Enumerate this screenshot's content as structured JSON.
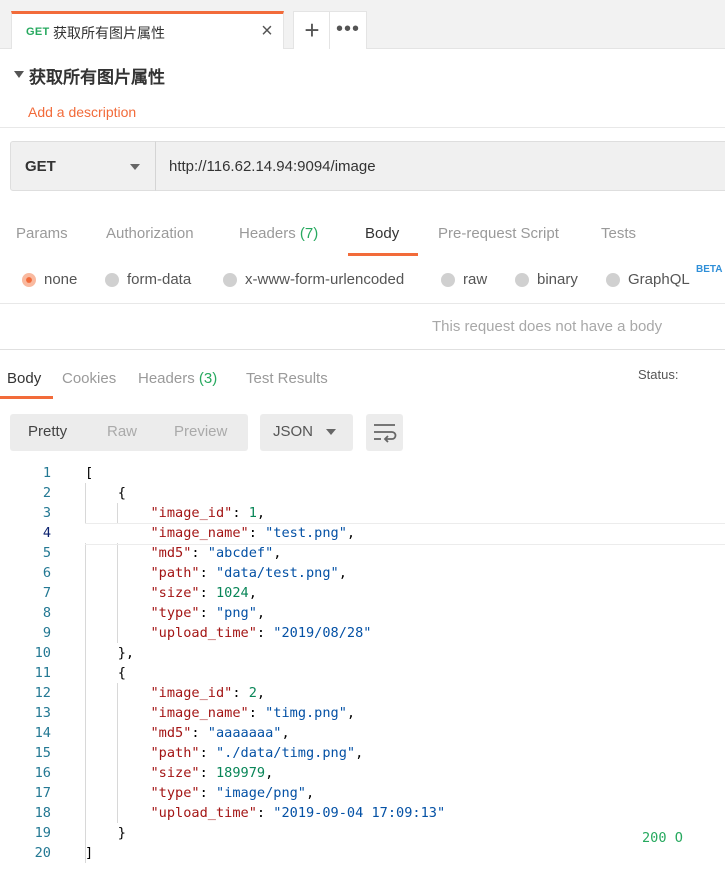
{
  "tab": {
    "method": "GET",
    "name": "获取所有图片属性",
    "close": "×",
    "add": "+",
    "more": "•••"
  },
  "request": {
    "title": "获取所有图片属性",
    "add_description": "Add a description",
    "method": "GET",
    "url": "http://116.62.14.94:9094/image"
  },
  "request_tabs": [
    {
      "label": "Params"
    },
    {
      "label": "Authorization"
    },
    {
      "label": "Headers",
      "count": "(7)"
    },
    {
      "label": "Body"
    },
    {
      "label": "Pre-request Script"
    },
    {
      "label": "Tests"
    }
  ],
  "body_types": [
    "none",
    "form-data",
    "x-www-form-urlencoded",
    "raw",
    "binary",
    "GraphQL"
  ],
  "body_types_selected": "none",
  "beta": "BETA",
  "no_body_text": "This request does not have a body",
  "response_tabs": [
    {
      "label": "Body"
    },
    {
      "label": "Cookies"
    },
    {
      "label": "Headers",
      "count": "(3)"
    },
    {
      "label": "Test Results"
    }
  ],
  "status": {
    "label": "Status:",
    "value": "200 O"
  },
  "view_modes": [
    "Pretty",
    "Raw",
    "Preview"
  ],
  "view_mode_selected": "Pretty",
  "format": "JSON",
  "highlighted_line": 4,
  "code_lines": [
    [
      [
        "p",
        "["
      ]
    ],
    [
      [
        "p",
        "    {"
      ]
    ],
    [
      [
        "p",
        "        "
      ],
      [
        "k",
        "\"image_id\""
      ],
      [
        "p",
        ": "
      ],
      [
        "n",
        "1"
      ],
      [
        "p",
        ","
      ]
    ],
    [
      [
        "p",
        "        "
      ],
      [
        "k",
        "\"image_name\""
      ],
      [
        "p",
        ": "
      ],
      [
        "s",
        "\"test.png\""
      ],
      [
        "p",
        ","
      ]
    ],
    [
      [
        "p",
        "        "
      ],
      [
        "k",
        "\"md5\""
      ],
      [
        "p",
        ": "
      ],
      [
        "s",
        "\"abcdef\""
      ],
      [
        "p",
        ","
      ]
    ],
    [
      [
        "p",
        "        "
      ],
      [
        "k",
        "\"path\""
      ],
      [
        "p",
        ": "
      ],
      [
        "s",
        "\"data/test.png\""
      ],
      [
        "p",
        ","
      ]
    ],
    [
      [
        "p",
        "        "
      ],
      [
        "k",
        "\"size\""
      ],
      [
        "p",
        ": "
      ],
      [
        "n",
        "1024"
      ],
      [
        "p",
        ","
      ]
    ],
    [
      [
        "p",
        "        "
      ],
      [
        "k",
        "\"type\""
      ],
      [
        "p",
        ": "
      ],
      [
        "s",
        "\"png\""
      ],
      [
        "p",
        ","
      ]
    ],
    [
      [
        "p",
        "        "
      ],
      [
        "k",
        "\"upload_time\""
      ],
      [
        "p",
        ": "
      ],
      [
        "s",
        "\"2019/08/28\""
      ]
    ],
    [
      [
        "p",
        "    },"
      ]
    ],
    [
      [
        "p",
        "    {"
      ]
    ],
    [
      [
        "p",
        "        "
      ],
      [
        "k",
        "\"image_id\""
      ],
      [
        "p",
        ": "
      ],
      [
        "n",
        "2"
      ],
      [
        "p",
        ","
      ]
    ],
    [
      [
        "p",
        "        "
      ],
      [
        "k",
        "\"image_name\""
      ],
      [
        "p",
        ": "
      ],
      [
        "s",
        "\"timg.png\""
      ],
      [
        "p",
        ","
      ]
    ],
    [
      [
        "p",
        "        "
      ],
      [
        "k",
        "\"md5\""
      ],
      [
        "p",
        ": "
      ],
      [
        "s",
        "\"aaaaaaa\""
      ],
      [
        "p",
        ","
      ]
    ],
    [
      [
        "p",
        "        "
      ],
      [
        "k",
        "\"path\""
      ],
      [
        "p",
        ": "
      ],
      [
        "s",
        "\"./data/timg.png\""
      ],
      [
        "p",
        ","
      ]
    ],
    [
      [
        "p",
        "        "
      ],
      [
        "k",
        "\"size\""
      ],
      [
        "p",
        ": "
      ],
      [
        "n",
        "189979"
      ],
      [
        "p",
        ","
      ]
    ],
    [
      [
        "p",
        "        "
      ],
      [
        "k",
        "\"type\""
      ],
      [
        "p",
        ": "
      ],
      [
        "s",
        "\"image/png\""
      ],
      [
        "p",
        ","
      ]
    ],
    [
      [
        "p",
        "        "
      ],
      [
        "k",
        "\"upload_time\""
      ],
      [
        "p",
        ": "
      ],
      [
        "s",
        "\"2019-09-04 17:09:13\""
      ]
    ],
    [
      [
        "p",
        "    }"
      ]
    ],
    [
      [
        "p",
        "]"
      ]
    ]
  ],
  "colors": {
    "accent": "#f26b3a",
    "green": "#27a95f",
    "beta": "#2f8fd8"
  }
}
